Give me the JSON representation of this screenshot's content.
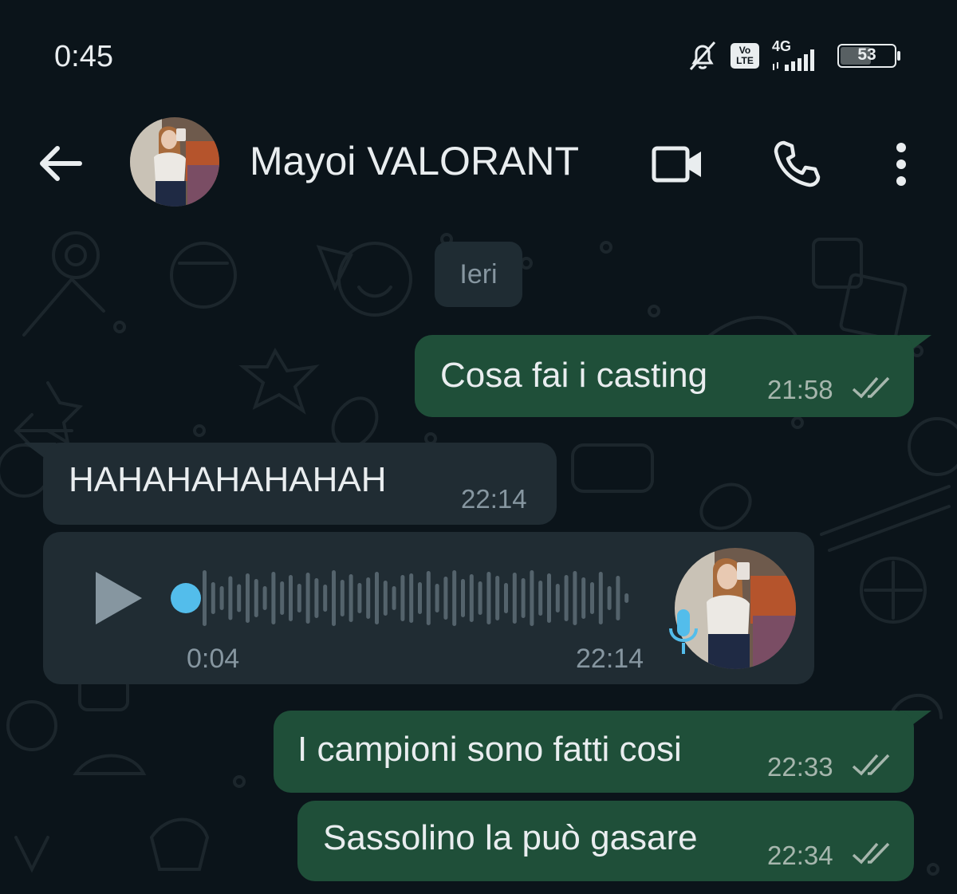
{
  "status_bar": {
    "time": "0:45",
    "volte_top": "Vo",
    "volte_bottom": "LTE",
    "network": "4G",
    "battery": "53"
  },
  "header": {
    "contact_name": "Mayoi VALORANT"
  },
  "chat": {
    "date_separator": "Ieri",
    "messages": [
      {
        "direction": "outgoing",
        "text": "Cosa fai i casting",
        "time": "21:58",
        "read": true
      },
      {
        "direction": "incoming",
        "text": "HAHAHAHAHAHAH",
        "time": "22:14"
      },
      {
        "direction": "incoming",
        "type": "voice",
        "duration": "0:04",
        "time": "22:14",
        "progress": 0
      },
      {
        "direction": "outgoing",
        "text": "I campioni sono fatti cosi",
        "time": "22:33",
        "read": true
      },
      {
        "direction": "outgoing",
        "text": "Sassolino la può gasare",
        "time": "22:34",
        "read": true
      }
    ]
  },
  "colors": {
    "outgoing_bubble": "#1f4f39",
    "incoming_bubble": "#202c33",
    "background": "#0b141a",
    "accent_blue": "#53bdeb"
  }
}
